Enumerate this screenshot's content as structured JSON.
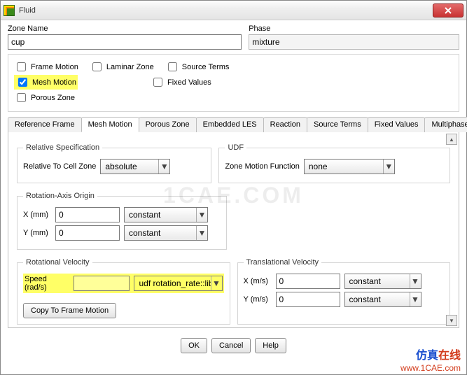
{
  "window": {
    "title": "Fluid"
  },
  "zone_name": {
    "label": "Zone Name",
    "value": "cup"
  },
  "phase": {
    "label": "Phase",
    "value": "mixture"
  },
  "options": {
    "frame_motion": "Frame Motion",
    "mesh_motion": "Mesh Motion",
    "porous_zone": "Porous Zone",
    "laminar_zone": "Laminar Zone",
    "source_terms": "Source Terms",
    "fixed_values": "Fixed Values"
  },
  "tabs": {
    "reference_frame": "Reference Frame",
    "mesh_motion": "Mesh Motion",
    "porous_zone": "Porous Zone",
    "embedded_les": "Embedded LES",
    "reaction": "Reaction",
    "source_terms": "Source Terms",
    "fixed_values": "Fixed Values",
    "multiphase": "Multiphase"
  },
  "mesh_motion": {
    "relative_spec": {
      "legend": "Relative Specification",
      "label": "Relative To Cell Zone",
      "value": "absolute"
    },
    "udf": {
      "legend": "UDF",
      "label": "Zone Motion Function",
      "value": "none"
    },
    "rotation_axis": {
      "legend": "Rotation-Axis Origin",
      "x_label": "X (mm)",
      "x_value": "0",
      "x_mode": "constant",
      "y_label": "Y (mm)",
      "y_value": "0",
      "y_mode": "constant"
    },
    "rotational_velocity": {
      "legend": "Rotational Velocity",
      "speed_label": "Speed (rad/s)",
      "speed_value": "",
      "speed_mode": "udf rotation_rate::libuc",
      "copy_btn": "Copy To Frame Motion"
    },
    "translational_velocity": {
      "legend": "Translational Velocity",
      "x_label": "X (m/s)",
      "x_value": "0",
      "x_mode": "constant",
      "y_label": "Y (m/s)",
      "y_value": "0",
      "y_mode": "constant"
    }
  },
  "buttons": {
    "ok": "OK",
    "cancel": "Cancel",
    "help": "Help"
  },
  "watermark": "1CAE.COM",
  "footer": {
    "cn1": "仿真",
    "cn2": "在线",
    "url": "www.1CAE.com"
  }
}
